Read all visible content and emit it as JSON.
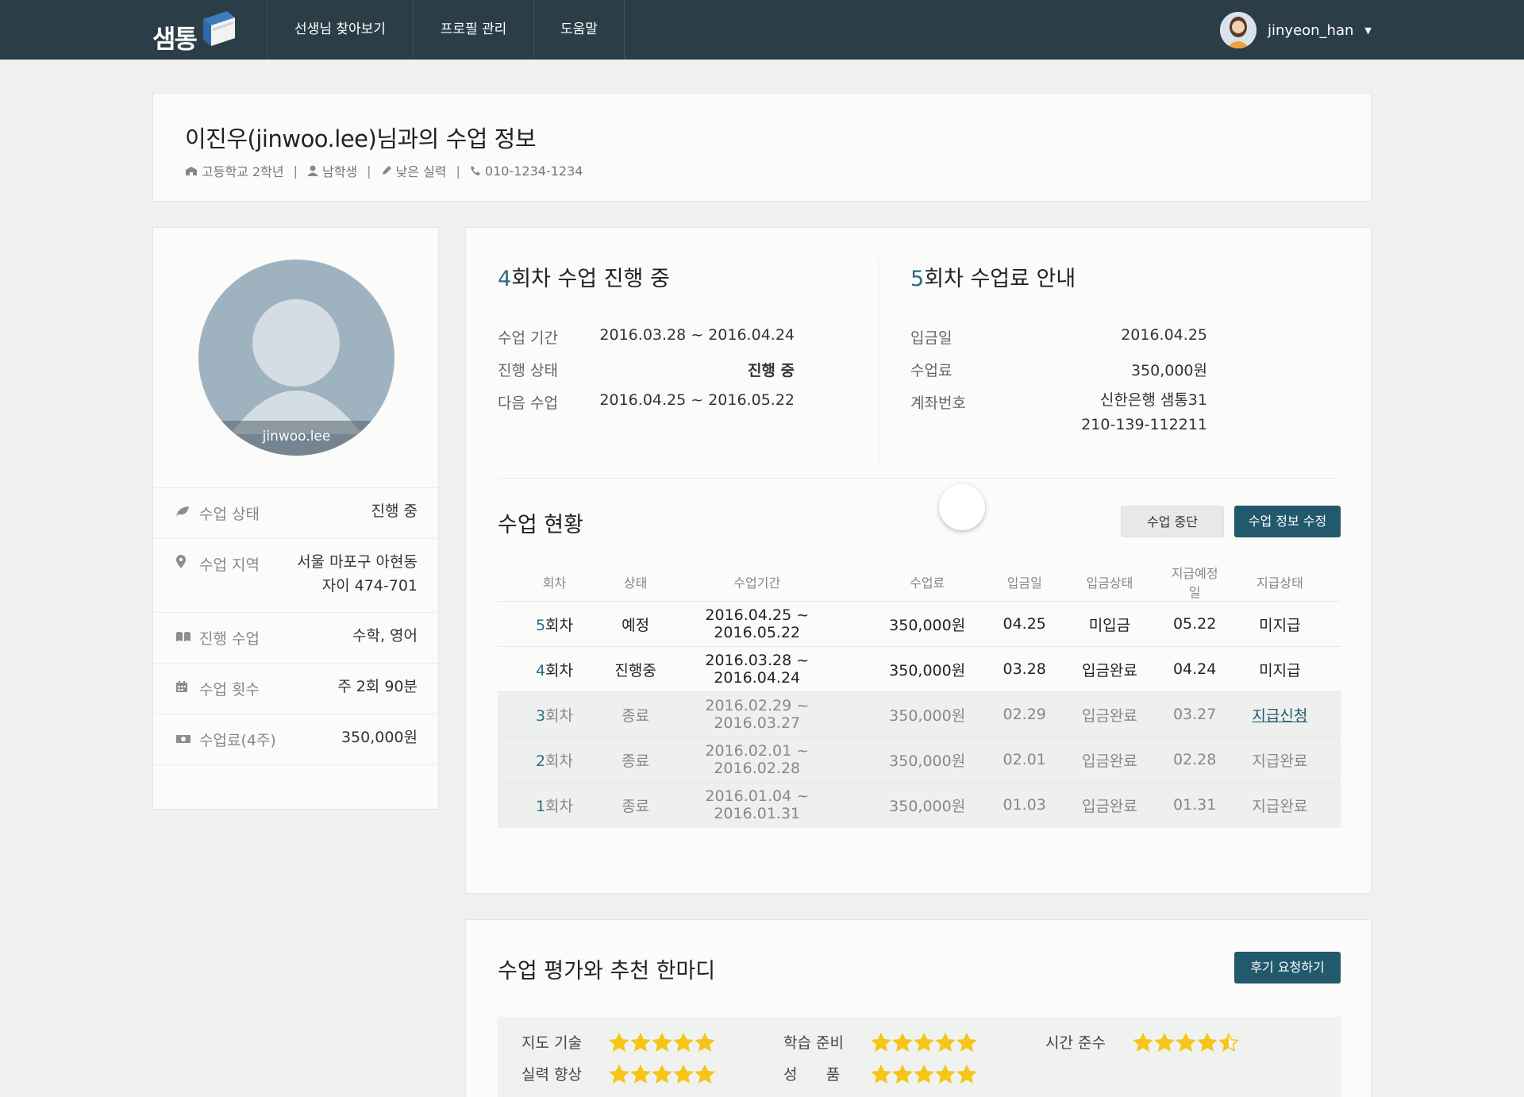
{
  "nav": {
    "logo_text": "샘통",
    "items": [
      "선생님 찾아보기",
      "프로필 관리",
      "도움말"
    ],
    "username": "jinyeon_han"
  },
  "header": {
    "title": "이진우(jinwoo.lee)님과의 수업 정보",
    "meta": [
      "고등학교 2학년",
      "남학생",
      "낮은 실력",
      "010-1234-1234"
    ]
  },
  "profile": {
    "avatar_name": "jinwoo.lee",
    "rows": [
      {
        "icon": "leaf-icon",
        "label": "수업 상태",
        "value": "진행 중"
      },
      {
        "icon": "map-marker-icon",
        "label": "수업 지역",
        "value": "서울 마포구 아현동",
        "value2": "자이 474-701"
      },
      {
        "icon": "book-icon",
        "label": "진행 수업",
        "value": "수학, 영어"
      },
      {
        "icon": "calendar-icon",
        "label": "수업 횟수",
        "value": "주 2회 90분"
      },
      {
        "icon": "money-icon",
        "label": "수업료(4주)",
        "value": "350,000원"
      }
    ]
  },
  "current": {
    "num": "4",
    "title_rest": "회차 수업 진행 중",
    "rows": [
      {
        "label": "수업 기간",
        "value": "2016.03.28 ~ 2016.04.24"
      },
      {
        "label": "진행 상태",
        "value": "진행 중"
      },
      {
        "label": "다음 수업",
        "value": "2016.04.25 ~ 2016.05.22"
      }
    ]
  },
  "fee": {
    "num": "5",
    "title_rest": "회차 수업료 안내",
    "rows": [
      {
        "label": "입금일",
        "value": "2016.04.25"
      },
      {
        "label": "수업료",
        "value": "350,000원"
      },
      {
        "label": "계좌번호",
        "value": "신한은행 샘통31",
        "value2": "210-139-112211"
      }
    ]
  },
  "status": {
    "title": "수업 현황",
    "stop_button": "수업 중단",
    "edit_button": "수업 정보 수정",
    "columns": [
      "회차",
      "상태",
      "수업기간",
      "수업료",
      "입금일",
      "입금상태",
      "지급예정일",
      "지급상태"
    ],
    "rows": [
      {
        "num": "5",
        "suffix": "회차",
        "state": "예정",
        "period": "2016.04.25 ~ 2016.05.22",
        "fee": "350,000원",
        "paid": "04.25",
        "pay_state": "미입금",
        "due": "05.22",
        "payout": "미지급",
        "past": false,
        "link": false
      },
      {
        "num": "4",
        "suffix": "회차",
        "state": "진행중",
        "period": "2016.03.28 ~ 2016.04.24",
        "fee": "350,000원",
        "paid": "03.28",
        "pay_state": "입금완료",
        "due": "04.24",
        "payout": "미지급",
        "past": false,
        "link": false
      },
      {
        "num": "3",
        "suffix": "회차",
        "state": "종료",
        "period": "2016.02.29 ~ 2016.03.27",
        "fee": "350,000원",
        "paid": "02.29",
        "pay_state": "입금완료",
        "due": "03.27",
        "payout": "지급신청",
        "past": true,
        "link": true
      },
      {
        "num": "2",
        "suffix": "회차",
        "state": "종료",
        "period": "2016.02.01 ~ 2016.02.28",
        "fee": "350,000원",
        "paid": "02.01",
        "pay_state": "입금완료",
        "due": "02.28",
        "payout": "지급완료",
        "past": true,
        "link": false
      },
      {
        "num": "1",
        "suffix": "회차",
        "state": "종료",
        "period": "2016.01.04 ~ 2016.01.31",
        "fee": "350,000원",
        "paid": "01.03",
        "pay_state": "입금완료",
        "due": "01.31",
        "payout": "지급완료",
        "past": true,
        "link": false
      }
    ]
  },
  "evaluation": {
    "title": "수업 평가와 추천 한마디",
    "review_button": "후기 요청하기",
    "items": [
      {
        "label": "지도 기술",
        "stars": 5
      },
      {
        "label": "학습 준비",
        "stars": 5
      },
      {
        "label": "시간 준수",
        "stars": 4.5
      },
      {
        "label": "실력 향상",
        "stars": 5
      },
      {
        "label": "성      품",
        "stars": 5
      }
    ]
  },
  "colors": {
    "nav_bg": "#2b3e47",
    "accent": "#22596c",
    "star": "#f5c518",
    "page_bg": "#eef1ed"
  }
}
